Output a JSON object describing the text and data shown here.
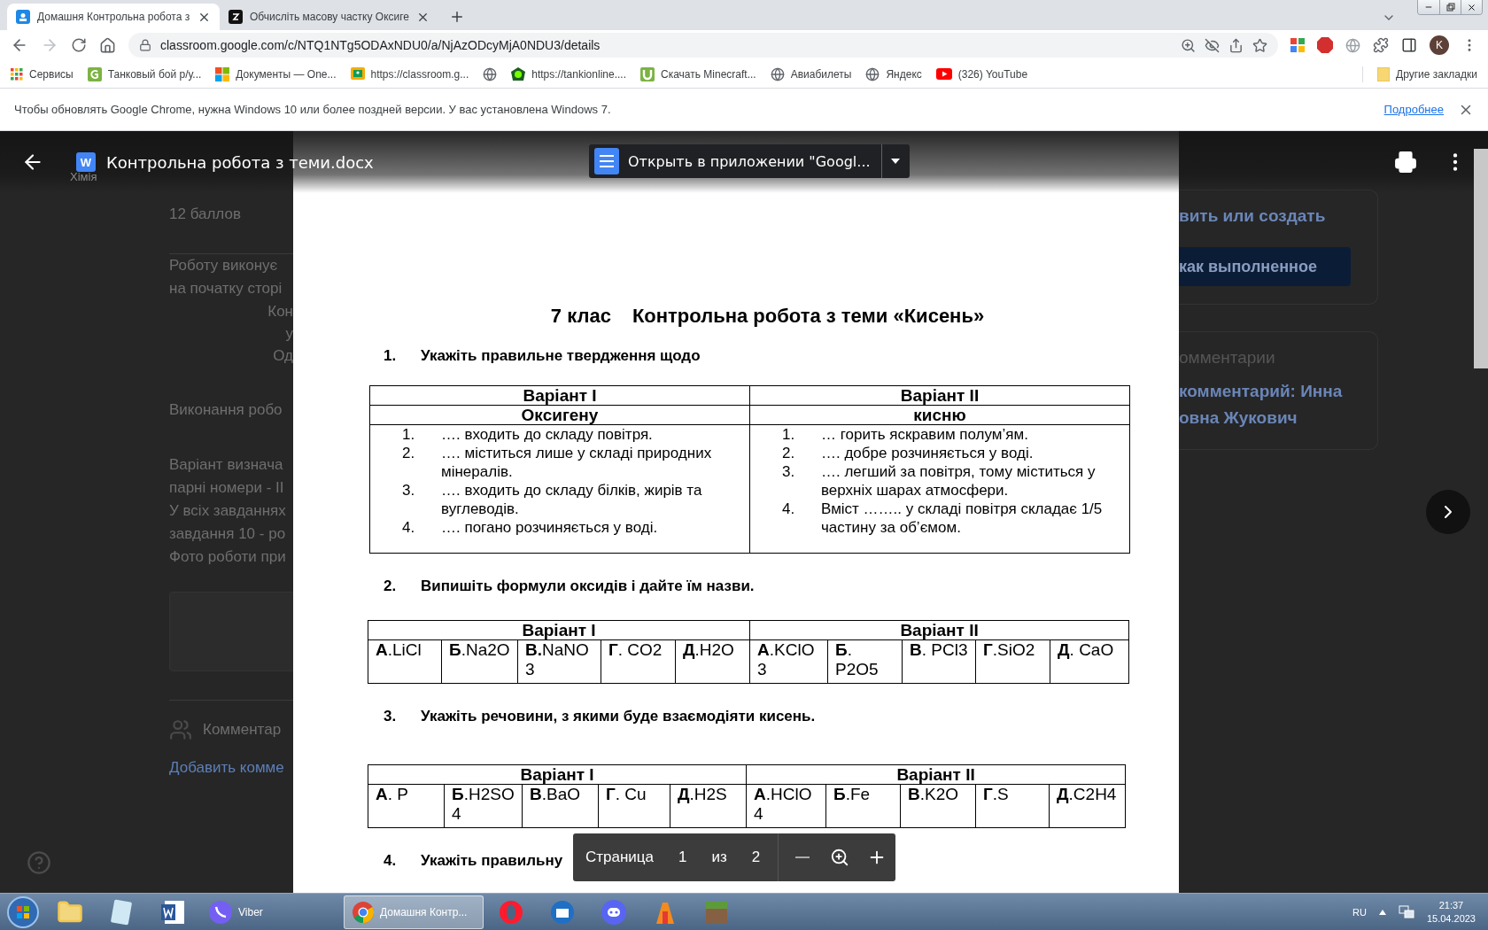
{
  "browser": {
    "tabs": [
      {
        "title": "Домашня Контрольна робота з",
        "kind": "classroom",
        "selected": true
      },
      {
        "title": "Обчисліть масову частку Оксиге",
        "kind": "znanija",
        "selected": false
      }
    ],
    "address": "classroom.google.com/c/NTQ1NTg5ODAxNDU0/a/NjAzODcyMjA0NDU3/details",
    "profile_initial": "K",
    "bookmarks": [
      {
        "kind": "apps",
        "label": "Сервисы"
      },
      {
        "kind": "letter",
        "label": "Танковый бой р/у..."
      },
      {
        "kind": "windows",
        "label": "Документы — One..."
      },
      {
        "kind": "classroom",
        "label": "https://classroom.g..."
      },
      {
        "kind": "globe"
      },
      {
        "kind": "tank",
        "label": "https://tankionline...."
      },
      {
        "kind": "torrent",
        "label": "Скачать Minecraft..."
      },
      {
        "kind": "globe",
        "label": "Авиабилеты"
      },
      {
        "kind": "globe",
        "label": "Яндекс"
      },
      {
        "kind": "youtube",
        "label": "(326) YouTube"
      }
    ],
    "other_bookmarks": "Другие закладки",
    "infobar": {
      "message": "Чтобы обновлять Google Chrome, нужна Windows 10 или более поздней версии. У вас установлена Windows 7.",
      "link": "Подробнее"
    }
  },
  "background_page": {
    "subject": "Хімія",
    "left": [
      {
        "kind": "points",
        "text": "12 баллов"
      },
      {
        "kind": "body",
        "text": "Роботу виконує"
      },
      {
        "kind": "body",
        "text": "на початку сторі"
      },
      {
        "kind": "center",
        "text": "Кон"
      },
      {
        "kind": "center",
        "text": "у"
      },
      {
        "kind": "center",
        "text": "Од"
      },
      {
        "kind": "gap",
        "text": "Виконання робо"
      },
      {
        "kind": "gap",
        "text": "Варіант визнача"
      },
      {
        "kind": "body",
        "text": "парні номери - ІІ"
      },
      {
        "kind": "body",
        "text": "У всіх завданнях"
      },
      {
        "kind": "body",
        "text": "завдання 10 - ро"
      },
      {
        "kind": "body",
        "text": "Фото роботи при"
      },
      {
        "kind": "attachment"
      },
      {
        "kind": "comments",
        "text": "Комментар"
      },
      {
        "kind": "link",
        "text": "Добавить комме"
      }
    ],
    "right": {
      "work_text": "вить или создать",
      "done_button": "как выполненное",
      "comments_title": "омментарии",
      "comment_link": [
        "комментарий: Инна",
        "овна Жукович"
      ]
    }
  },
  "viewer": {
    "file_icon": "W",
    "file_title": "Контрольна робота з теми.docx",
    "open_button": "Открыть в приложении \"Googl...",
    "page_label": "Страница",
    "page": "1",
    "of": "из",
    "pages": "2"
  },
  "document": {
    "grade": "7 клас",
    "title": "Контрольна робота з теми «Кисень»",
    "questions": [
      {
        "number": "1.",
        "text": "Укажіть правильне твердження щодо",
        "table": {
          "kind": "statements",
          "variants": [
            {
              "label": "Варіант І",
              "subject": "Оксигену",
              "items": [
                {
                  "number": "1.",
                  "text": "…. входить до складу повітря."
                },
                {
                  "number": "2.",
                  "text": "…. міститься лише у складі природних мінералів."
                },
                {
                  "number": "3.",
                  "text": "…. входить до складу білків, жирів та вуглеводів."
                },
                {
                  "number": "4.",
                  "text": "…. погано розчиняється у воді."
                }
              ]
            },
            {
              "label": "Варіант ІІ",
              "subject": "кисню",
              "items": [
                {
                  "number": "1.",
                  "text": "… горить яскравим полум’ям."
                },
                {
                  "number": "2.",
                  "text": "…. добре розчиняється у воді."
                },
                {
                  "number": "3.",
                  "text": "…. легший за повітря, тому міститься у верхніх шарах атмосфери."
                },
                {
                  "number": "4.",
                  "text": "Вміст …….. у складі повітря складає 1/5 частину за об’ємом."
                }
              ]
            }
          ]
        }
      },
      {
        "number": "2.",
        "text": "Випишіть формули оксидів і дайте їм назви.",
        "table": {
          "kind": "options",
          "variants": [
            {
              "label": "Варіант І",
              "cells": [
                "**А**.LiCl",
                "**Б**.Na2O",
                "**В.**NaNO3",
                "**Г**. CO2",
                "**Д**.H2O"
              ]
            },
            {
              "label": "Варіант ІІ",
              "cells": [
                "**А**.KClO3",
                "**Б**. P2O5",
                "**В**. PCl3",
                "**Г**.SiO2",
                "**Д**. CaO"
              ]
            }
          ]
        }
      },
      {
        "number": "3.",
        "text": "Укажіть речовини, з якими буде взаємодіяти кисень.",
        "table": {
          "kind": "options",
          "variants": [
            {
              "label": "Варіант І",
              "cells": [
                "**А**. P",
                "**Б**.H2SO4",
                "**В**.BaO",
                "**Г**. Cu",
                "**Д**.H2S"
              ]
            },
            {
              "label": "Варіант ІІ",
              "cells": [
                "**А**.HClO4",
                "**Б**.Fe",
                "**В**.K2O",
                "**Г**.S",
                "**Д**.C2H4"
              ]
            }
          ]
        }
      },
      {
        "number": "4.",
        "text": "Укажіть правильну"
      }
    ]
  },
  "taskbar": {
    "apps": [
      {
        "kind": "explorer",
        "selected": false
      },
      {
        "kind": "notes",
        "selected": false
      },
      {
        "kind": "word",
        "selected": false
      },
      {
        "kind": "viber",
        "label": "Viber",
        "selected": false
      },
      {
        "kind": "chrome",
        "label": "Домашня Контр...",
        "selected": true
      },
      {
        "kind": "opera",
        "selected": false
      },
      {
        "kind": "thunderbird",
        "selected": false
      },
      {
        "kind": "discord",
        "selected": false
      },
      {
        "kind": "launcher",
        "selected": false
      },
      {
        "kind": "minecraft",
        "selected": false
      }
    ],
    "language": "RU",
    "time": "21:37",
    "date": "15.04.2023"
  }
}
